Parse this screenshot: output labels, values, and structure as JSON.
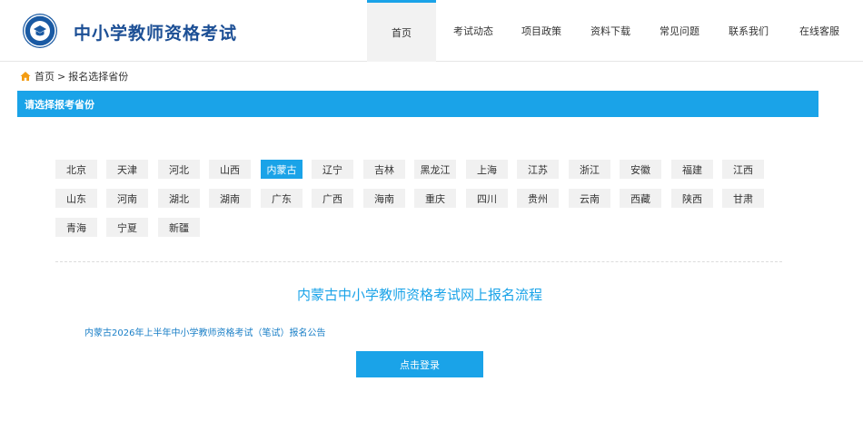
{
  "header": {
    "site_title": "中小学教师资格考试",
    "logo_icon": "teacher-exam-logo"
  },
  "nav": {
    "items": [
      {
        "label": "首页",
        "active": true
      },
      {
        "label": "考试动态",
        "active": false
      },
      {
        "label": "项目政策",
        "active": false
      },
      {
        "label": "资料下载",
        "active": false
      },
      {
        "label": "常见问题",
        "active": false
      },
      {
        "label": "联系我们",
        "active": false
      },
      {
        "label": "在线客服",
        "active": false
      }
    ]
  },
  "breadcrumb": {
    "home": "首页",
    "separator": ">",
    "current": "报名选择省份",
    "icon": "home-icon"
  },
  "panel": {
    "title": "请选择报考省份"
  },
  "provinces": {
    "rows": [
      [
        "北京",
        "天津",
        "河北",
        "山西",
        "内蒙古",
        "辽宁",
        "吉林",
        "黑龙江",
        "上海",
        "江苏",
        "浙江",
        "安徽",
        "福建",
        "江西"
      ],
      [
        "山东",
        "河南",
        "湖北",
        "湖南",
        "广东",
        "广西",
        "海南",
        "重庆",
        "四川",
        "贵州",
        "云南",
        "西藏",
        "陕西",
        "甘肃"
      ],
      [
        "青海",
        "宁夏",
        "新疆"
      ]
    ],
    "selected": "内蒙古"
  },
  "flow": {
    "title": "内蒙古中小学教师资格考试网上报名流程",
    "notice_link": "内蒙古2026年上半年中小学教师资格考试（笔试）报名公告",
    "login_button": "点击登录"
  },
  "colors": {
    "accent": "#1aa3e8",
    "brand": "#1c4f95",
    "link": "#1a7fc7",
    "home_icon": "#f39c12"
  }
}
